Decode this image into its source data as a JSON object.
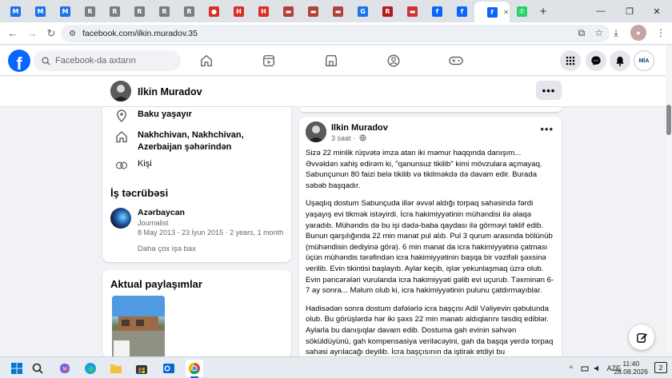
{
  "browser": {
    "tabs": [
      {
        "icon": "gmail-icon",
        "label": "M",
        "color": "#1a73e8"
      },
      {
        "icon": "gmail-icon",
        "label": "M",
        "color": "#1a73e8"
      },
      {
        "icon": "gmail-icon",
        "label": "M",
        "color": "#1a73e8"
      },
      {
        "icon": "news-icon",
        "label": "R",
        "color": "#7c7c7c"
      },
      {
        "icon": "news-icon",
        "label": "R",
        "color": "#7c7c7c"
      },
      {
        "icon": "news-icon",
        "label": "R",
        "color": "#7c7c7c"
      },
      {
        "icon": "news-icon",
        "label": "R",
        "color": "#7c7c7c"
      },
      {
        "icon": "news-icon",
        "label": "R",
        "color": "#7c7c7c"
      },
      {
        "icon": "record-icon",
        "label": "●",
        "color": "#d93025"
      },
      {
        "icon": "h-site-icon",
        "label": "H",
        "color": "#d93025"
      },
      {
        "icon": "h-site-icon",
        "label": "H",
        "color": "#d93025"
      },
      {
        "icon": "news-icon",
        "label": "▬",
        "color": "#b0423a"
      },
      {
        "icon": "news-icon",
        "label": "▬",
        "color": "#b0423a"
      },
      {
        "icon": "news-icon",
        "label": "▬",
        "color": "#b0423a"
      },
      {
        "icon": "translate-icon",
        "label": "G",
        "color": "#1a73e8"
      },
      {
        "icon": "r-site-icon",
        "label": "R",
        "color": "#b31b1b"
      },
      {
        "icon": "news-icon",
        "label": "▬",
        "color": "#c33"
      },
      {
        "icon": "facebook-icon",
        "label": "f",
        "color": "#0866ff"
      },
      {
        "icon": "facebook-icon",
        "label": "f",
        "color": "#0866ff"
      },
      {
        "icon": "facebook-icon",
        "label": "f",
        "color": "#0866ff",
        "active": true
      },
      {
        "icon": "whatsapp-icon",
        "label": "✆",
        "color": "#25d366"
      }
    ],
    "url": "facebook.com/ilkin.muradov.35"
  },
  "facebook": {
    "search_placeholder": "Facebook-da axtarın",
    "avatar_text": "MİA"
  },
  "profile": {
    "name": "Ilkin Muradov",
    "menu_dots": "•••"
  },
  "intro": {
    "lives": "Baku yaşayır",
    "from": "Nakhchivan, Nakhchivan, Azerbaijan şəhərindən",
    "gender": "Kişi",
    "work_title": "İş təcrübəsi",
    "work": {
      "company": "Azərbaycan",
      "role": "Journalist",
      "dates": "8 May 2013 - 23 İyun 2015 · 2 years, 1 month"
    },
    "see_more": "Daha çox işə bax"
  },
  "featured": {
    "title": "Aktual paylaşımlar"
  },
  "post": {
    "author": "Ilkin Muradov",
    "time": "3 saat ·",
    "more": "•••",
    "paragraphs": [
      "Sizə 22 minlik rüşvətə imza atan iki məmur haqqında danışım... Əvvəldən xahiş edirəm ki, \"qanunsuz tikilib\" kimi mövzulara açmayaq. Sabunçunun 80 faizi belə tikilib və tikilməkdə də davam edir. Burada səbəb başqadır.",
      "Uşaqlıq dostum Sabunçuda illər əvvəl aldığı torpaq sahəsində fərdi yaşayış evi tikmək istəyirdi. İcra hakimiyyətinin mühəndisi ilə əlaqə yaradıb. Mühəndis də bu işi dədə-baba qaydası ilə görməyi təklif edib. Bunun qarşılığında 22 min manat pul alıb. Pul 3 qurum arasında bölünüb (mühəndisin dediyinə görə). 6 min manat da icra hakimiyyətinə çatması üçün mühəndis tərəfindən icra hakimiyyətinin başqa bir vəzifəli şəxsinə verilib. Evin tikintisi başlayıb. Aylar keçib, işlər yekunlaşmaq üzrə olub. Evin pəncərələri vurulanda icra hakimiyyəti gəlib evi uçurub. Təxminən 6-7 ay sonra... Məlum olub ki, icra hakimiyyətinin pulunu çatdırmayıblar.",
      "Hadisədən sonra dostum dəfələrlə icra başçısı Adil Vəliyevin qəbulunda olub. Bu görüşlərdə hər iki şəxs 22 min manatı aldıqlarını təsdiq ediblər. Aylarla bu danışıqlar davam edib. Dostuma gah evinin səhvən söküldüyünü, gah kompensasiya veriləcəyini, gah da başqa yerdə torpaq sahəsi ayrılacağı deyilib. İcra başçısının da iştirak etdiyi bu"
    ]
  },
  "taskbar": {
    "lang": "AZE",
    "time": "11:40",
    "date": "28.08.2026",
    "notifications": "2"
  }
}
